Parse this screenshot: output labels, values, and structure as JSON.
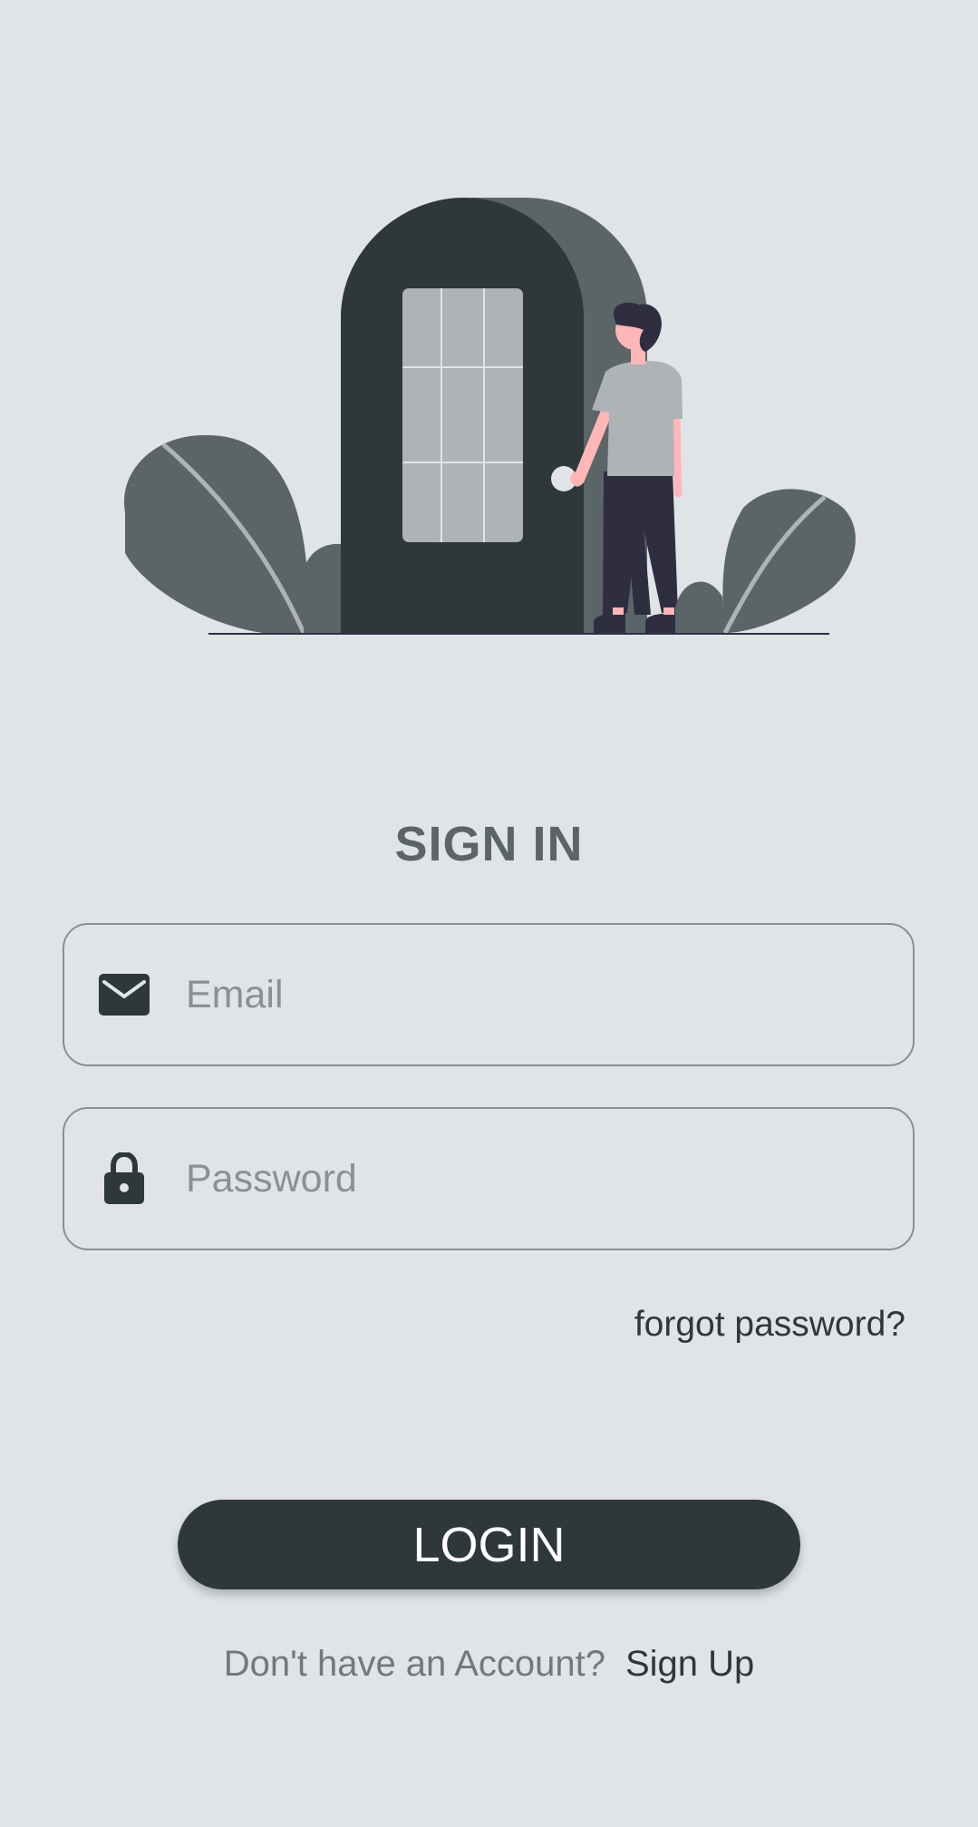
{
  "colors": {
    "background": "#e0e4e7",
    "primary": "#2e383b",
    "secondary": "#5b6568",
    "placeholder": "#8c9093",
    "border": "#8b8f92"
  },
  "illustration": {
    "icon": "person-at-door-illustration"
  },
  "title": "SIGN IN",
  "email": {
    "icon": "envelope-icon",
    "placeholder": "Email",
    "value": ""
  },
  "password": {
    "icon": "lock-icon",
    "placeholder": "Password",
    "value": ""
  },
  "forgot_password": "forgot password?",
  "login_button": "LOGIN",
  "signup": {
    "prompt": "Don't have an Account?",
    "link": "Sign Up"
  }
}
